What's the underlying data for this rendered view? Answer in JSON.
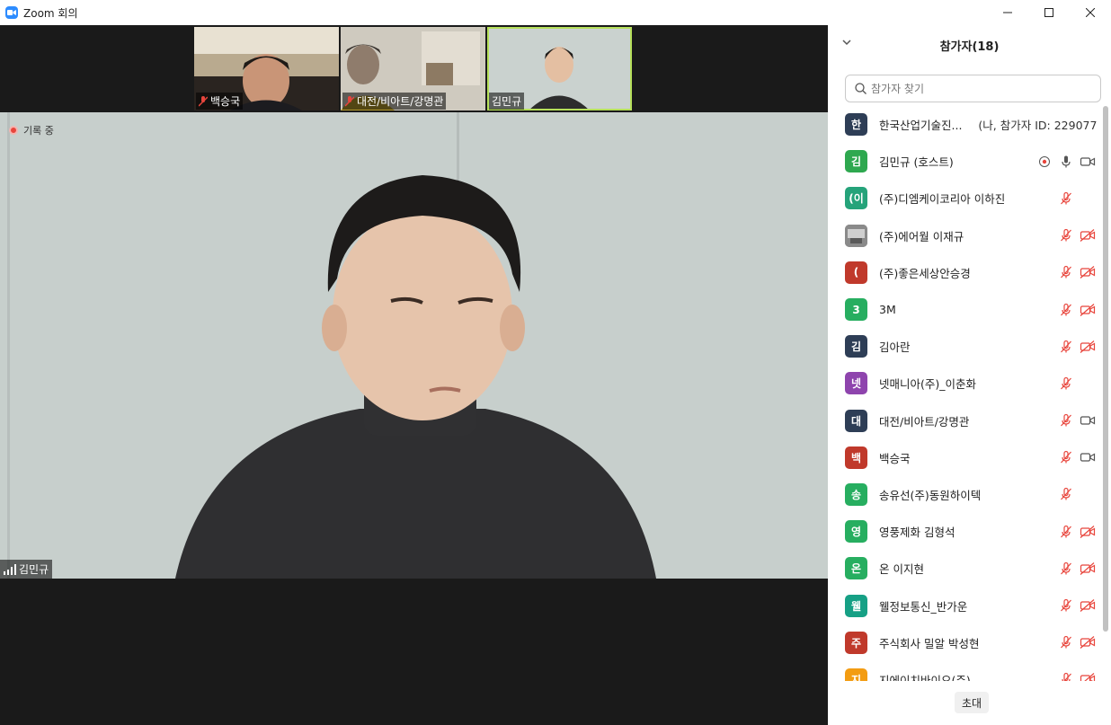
{
  "window": {
    "title": "Zoom 회의"
  },
  "thumbnails": [
    {
      "name": "백승국",
      "muted": true
    },
    {
      "name": "대전/비아트/강명관",
      "muted": true
    },
    {
      "name": "김민규",
      "muted": false
    }
  ],
  "main_video": {
    "recording_label": "기록 중",
    "speaker_name": "김민규"
  },
  "panel": {
    "title": "참가자(18)",
    "search_placeholder": "참가자 찾기",
    "invite_label": "초대",
    "participants": [
      {
        "initial": "한",
        "name": "한국산업기술진...",
        "extra": "(나, 참가자 ID: 229077)",
        "color": "#2e3e56",
        "mic": "none",
        "cam": "none"
      },
      {
        "initial": "김",
        "name": "김민규 (호스트)",
        "extra": "",
        "color": "#2ea84f",
        "mic": "on",
        "cam": "on",
        "recording": true
      },
      {
        "initial": "(이",
        "name": "(주)디엠케이코리아 이하진",
        "extra": "",
        "color": "#25a37a",
        "mic": "muted",
        "cam": "none"
      },
      {
        "initial": "",
        "name": "(주)에어월 이재규",
        "extra": "",
        "color": "#777777",
        "mic": "muted",
        "cam": "off",
        "photo": true
      },
      {
        "initial": "(",
        "name": "(주)좋은세상안승경",
        "extra": "",
        "color": "#c0392b",
        "mic": "muted",
        "cam": "off"
      },
      {
        "initial": "3",
        "name": "3M",
        "extra": "",
        "color": "#27ae60",
        "mic": "muted",
        "cam": "off"
      },
      {
        "initial": "김",
        "name": "김아란",
        "extra": "",
        "color": "#2e3e56",
        "mic": "muted",
        "cam": "off"
      },
      {
        "initial": "넷",
        "name": "넷매니아(주)_이춘화",
        "extra": "",
        "color": "#8e44ad",
        "mic": "muted",
        "cam": "none"
      },
      {
        "initial": "대",
        "name": "대전/비아트/강명관",
        "extra": "",
        "color": "#2e3e56",
        "mic": "muted",
        "cam": "on"
      },
      {
        "initial": "백",
        "name": "백승국",
        "extra": "",
        "color": "#c0392b",
        "mic": "muted",
        "cam": "on"
      },
      {
        "initial": "송",
        "name": "송유선(주)동원하이텍",
        "extra": "",
        "color": "#27ae60",
        "mic": "muted",
        "cam": "none"
      },
      {
        "initial": "영",
        "name": "영풍제화  김형석",
        "extra": "",
        "color": "#27ae60",
        "mic": "muted",
        "cam": "off"
      },
      {
        "initial": "온",
        "name": "온 이지현",
        "extra": "",
        "color": "#27ae60",
        "mic": "muted",
        "cam": "off"
      },
      {
        "initial": "웰",
        "name": "웰정보통신_반가운",
        "extra": "",
        "color": "#16a085",
        "mic": "muted",
        "cam": "off"
      },
      {
        "initial": "주",
        "name": "주식회사 밀알 박성현",
        "extra": "",
        "color": "#c0392b",
        "mic": "muted",
        "cam": "off"
      },
      {
        "initial": "지",
        "name": "지에이치바이오(주)",
        "extra": "",
        "color": "#f39c12",
        "mic": "muted",
        "cam": "off"
      }
    ]
  }
}
